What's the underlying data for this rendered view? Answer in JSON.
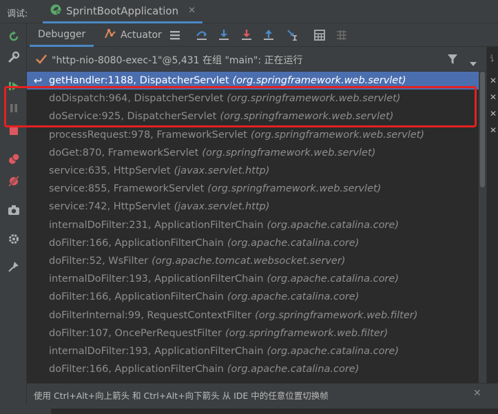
{
  "titlebar": {
    "label": "调试:",
    "tab_name": "SprintBootApplication",
    "tab_close": "✕"
  },
  "toolbar": {
    "tabs": [
      {
        "label": "Debugger"
      },
      {
        "label": "Actuator"
      }
    ]
  },
  "thread": {
    "text": "\"http-nio-8080-exec-1\"@5,431 在组 \"main\": 正在运行"
  },
  "frames": [
    {
      "method": "getHandler:1188, DispatcherServlet",
      "pkg": "(org.springframework.web.servlet)"
    },
    {
      "method": "doDispatch:964, DispatcherServlet",
      "pkg": "(org.springframework.web.servlet)"
    },
    {
      "method": "doService:925, DispatcherServlet",
      "pkg": "(org.springframework.web.servlet)"
    },
    {
      "method": "processRequest:978, FrameworkServlet",
      "pkg": "(org.springframework.web.servlet)"
    },
    {
      "method": "doGet:870, FrameworkServlet",
      "pkg": "(org.springframework.web.servlet)"
    },
    {
      "method": "service:635, HttpServlet",
      "pkg": "(javax.servlet.http)"
    },
    {
      "method": "service:855, FrameworkServlet",
      "pkg": "(org.springframework.web.servlet)"
    },
    {
      "method": "service:742, HttpServlet",
      "pkg": "(javax.servlet.http)"
    },
    {
      "method": "internalDoFilter:231, ApplicationFilterChain",
      "pkg": "(org.apache.catalina.core)"
    },
    {
      "method": "doFilter:166, ApplicationFilterChain",
      "pkg": "(org.apache.catalina.core)"
    },
    {
      "method": "doFilter:52, WsFilter",
      "pkg": "(org.apache.tomcat.websocket.server)"
    },
    {
      "method": "internalDoFilter:193, ApplicationFilterChain",
      "pkg": "(org.apache.catalina.core)"
    },
    {
      "method": "doFilter:166, ApplicationFilterChain",
      "pkg": "(org.apache.catalina.core)"
    },
    {
      "method": "doFilterInternal:99, RequestContextFilter",
      "pkg": "(org.springframework.web.filter)"
    },
    {
      "method": "doFilter:107, OncePerRequestFilter",
      "pkg": "(org.springframework.web.filter)"
    },
    {
      "method": "internalDoFilter:193, ApplicationFilterChain",
      "pkg": "(org.apache.catalina.core)"
    },
    {
      "method": "doFilter:166, ApplicationFilterChain",
      "pkg": "(org.apache.catalina.core)"
    }
  ],
  "selected_frame_index": 0,
  "right_panel": {
    "header": "讠",
    "items": [
      "✕",
      "✕",
      "✕",
      "✕"
    ]
  },
  "statusbar": {
    "hint": "使用 Ctrl+Alt+向上箭头 和 Ctrl+Alt+向下箭头 从 IDE 中的任意位置切换帧",
    "close": "✕"
  },
  "colors": {
    "accent": "#4a88c7",
    "selection": "#4b6eaf",
    "highlight_box": "#e62020",
    "resume_green": "#59a869",
    "stop_red": "#db5860"
  }
}
